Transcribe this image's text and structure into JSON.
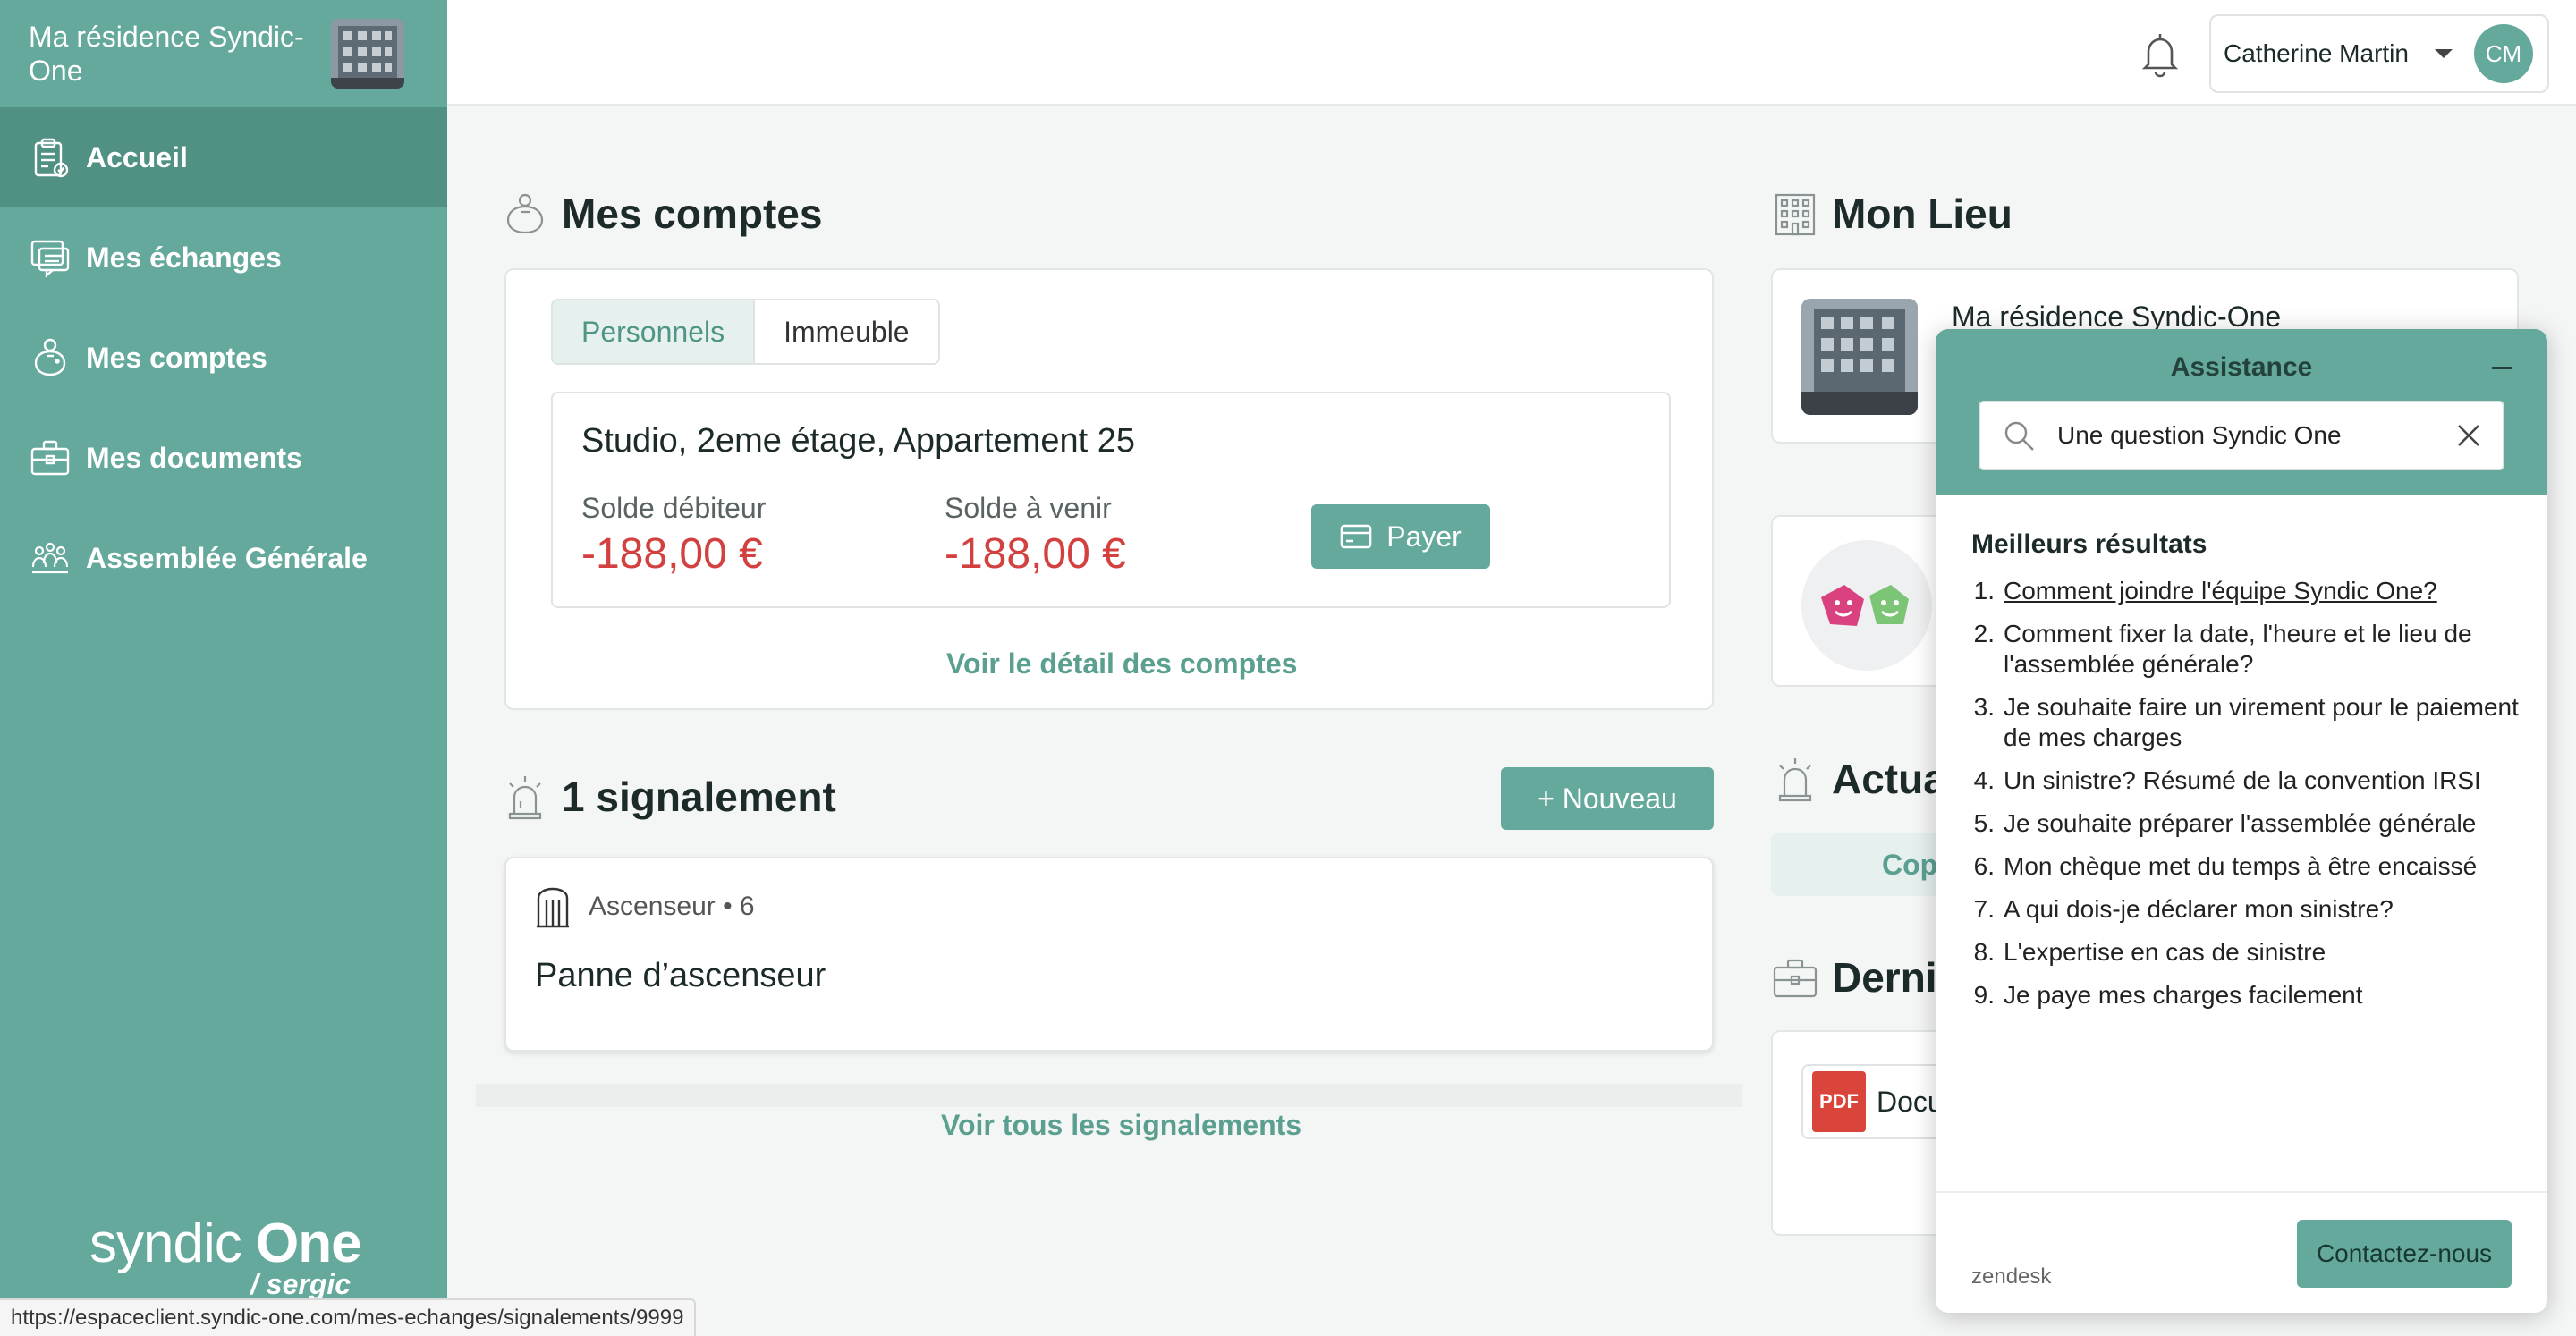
{
  "sidebar": {
    "residence_title": "Ma résidence Syndic-One",
    "items": [
      {
        "label": "Accueil",
        "icon": "clipboard-icon",
        "active": true
      },
      {
        "label": "Mes échanges",
        "icon": "chat-icon",
        "active": false
      },
      {
        "label": "Mes comptes",
        "icon": "piggy-bank-icon",
        "active": false
      },
      {
        "label": "Mes documents",
        "icon": "briefcase-icon",
        "active": false
      },
      {
        "label": "Assemblée Générale",
        "icon": "people-icon",
        "active": false
      }
    ],
    "logo_syndic": "syndic",
    "logo_one": "One",
    "logo_sergic": "/ sergic"
  },
  "topbar": {
    "user_name": "Catherine Martin",
    "user_initials": "CM"
  },
  "comptes": {
    "title": "Mes comptes",
    "tabs": [
      "Personnels",
      "Immeuble"
    ],
    "apartment": "Studio, 2eme étage, Appartement 25",
    "solde_debiteur_label": "Solde débiteur",
    "solde_debiteur_value": "-188,00 €",
    "solde_avenir_label": "Solde à venir",
    "solde_avenir_value": "-188,00 €",
    "pay_label": "Payer",
    "detail_link": "Voir le détail des comptes"
  },
  "signalements": {
    "title": "1 signalement",
    "new_label": "+ Nouveau",
    "item_meta": "Ascenseur • 6",
    "item_title": "Panne d’ascenseur",
    "all_link": "Voir tous les signalements"
  },
  "lieu": {
    "title": "Mon Lieu",
    "residence_name": "Ma résidence Syndic-One"
  },
  "actualites": {
    "title_visible": "Actua",
    "copro_visible": "Cop"
  },
  "documents": {
    "title_visible": "Derni",
    "doc_visible": "Docu",
    "pdf_label": "PDF"
  },
  "assistance": {
    "title": "Assistance",
    "search_value": "Une question Syndic One",
    "results_heading": "Meilleurs résultats",
    "results": [
      "Comment joindre l'équipe Syndic One?",
      "Comment fixer la date, l'heure et le lieu de l'assemblée générale?",
      "Je souhaite faire un virement pour le paiement de mes charges",
      "Un sinistre? Résumé de la convention IRSI",
      "Je souhaite préparer l'assemblée générale",
      "Mon chèque met du temps à être encaissé",
      "A qui dois-je déclarer mon sinistre?",
      "L'expertise en cas de sinistre",
      "Je paye mes charges facilement"
    ],
    "result_numbers": [
      "1.",
      "2.",
      "3.",
      "4.",
      "5.",
      "6.",
      "7.",
      "8.",
      "9."
    ],
    "brand": "zendesk",
    "contact_label": "Contactez-nous"
  },
  "status_url": "https://espaceclient.syndic-one.com/mes-echanges/signalements/9999",
  "colors": {
    "primary": "#64a99b",
    "primary_dark": "#519184",
    "negative": "#d2403f"
  }
}
